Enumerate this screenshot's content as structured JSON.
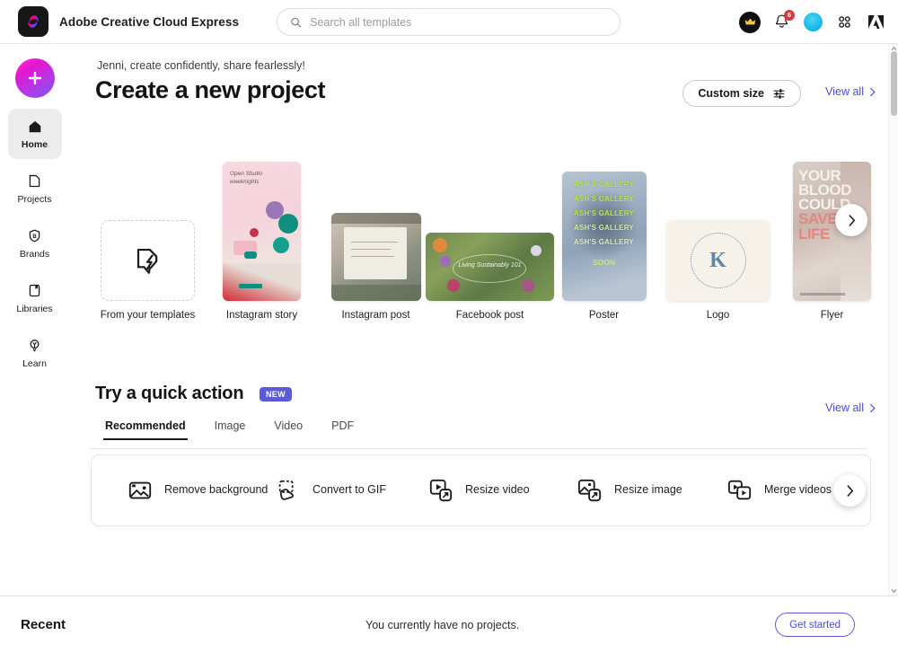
{
  "app": {
    "brand_name": "Adobe Creative Cloud Express",
    "brand_logo_icon": "creative-cloud-express-logo"
  },
  "search": {
    "placeholder": "Search all templates",
    "value": "",
    "icon": "search-icon"
  },
  "topbar_actions": {
    "crown_icon": "crown-icon",
    "bell_icon": "bell-icon",
    "notification_count": "6",
    "avatar_icon": "user-avatar",
    "apps_grid_icon": "apps-grid-icon",
    "adobe_icon": "adobe-logo-icon"
  },
  "sidebar": {
    "create_button_icon": "plus-icon",
    "items": [
      {
        "label": "Home",
        "icon": "home-icon",
        "active": true
      },
      {
        "label": "Projects",
        "icon": "projects-icon",
        "active": false
      },
      {
        "label": "Brands",
        "icon": "brands-shield-icon",
        "active": false
      },
      {
        "label": "Libraries",
        "icon": "libraries-icon",
        "active": false
      },
      {
        "label": "Learn",
        "icon": "learn-bulb-icon",
        "active": false
      }
    ]
  },
  "main": {
    "greeting": "Jenni, create confidently, share fearlessly!",
    "title": "Create a new project",
    "custom_size_label": "Custom size",
    "custom_size_icon": "sliders-icon",
    "view_all_label": "View all",
    "view_all_chevron": "chevron-right-icon",
    "next_arrow_icon": "chevron-right-icon"
  },
  "templates": [
    {
      "label": "From your templates",
      "thumb": "dashed-placeholder",
      "icon": "template-spark-icon"
    },
    {
      "label": "Instagram story",
      "thumb": "pink-craft-photo",
      "overlay_text": "Open Studio\nweeknights"
    },
    {
      "label": "Instagram post",
      "thumb": "textured-note-photo"
    },
    {
      "label": "Facebook post",
      "thumb": "wildflower-photo",
      "overlay_text": "Living Sustainably 101"
    },
    {
      "label": "Poster",
      "thumb": "cloudy-sky-poster",
      "overlay_lines": [
        "ASH'S GALLERY",
        "ASH'S GALLERY",
        "ASH'S GALLERY",
        "ASH'S GALLERY",
        "ASH'S GALLERY"
      ],
      "overlay_footer": "SOON"
    },
    {
      "label": "Logo",
      "thumb": "cream-circle-monogram",
      "monogram": "K"
    },
    {
      "label": "Flyer",
      "thumb": "blood-drive-photo",
      "overlay_lines": [
        "YOUR",
        "BLOOD",
        "COULD",
        "SAVE A",
        "LIFE"
      ]
    }
  ],
  "quick_action": {
    "title": "Try a quick action",
    "new_badge": "NEW",
    "view_all_label": "View all",
    "tabs": [
      {
        "label": "Recommended",
        "active": true
      },
      {
        "label": "Image",
        "active": false
      },
      {
        "label": "Video",
        "active": false
      },
      {
        "label": "PDF",
        "active": false
      }
    ],
    "actions": [
      {
        "label": "Remove background",
        "icon": "remove-background-icon"
      },
      {
        "label": "Convert to GIF",
        "icon": "convert-to-gif-icon"
      },
      {
        "label": "Resize video",
        "icon": "resize-video-icon"
      },
      {
        "label": "Resize image",
        "icon": "resize-image-icon"
      },
      {
        "label": "Merge videos",
        "icon": "merge-videos-icon"
      }
    ],
    "next_arrow_icon": "chevron-right-icon"
  },
  "recent": {
    "title": "Recent",
    "empty_message": "You currently have no projects.",
    "get_started_label": "Get started"
  },
  "colors": {
    "accent_purple": "#5b5bd6",
    "link_blue": "#4a4ad6",
    "badge_red": "#d7373f",
    "active_nav_bg": "#ececec"
  }
}
